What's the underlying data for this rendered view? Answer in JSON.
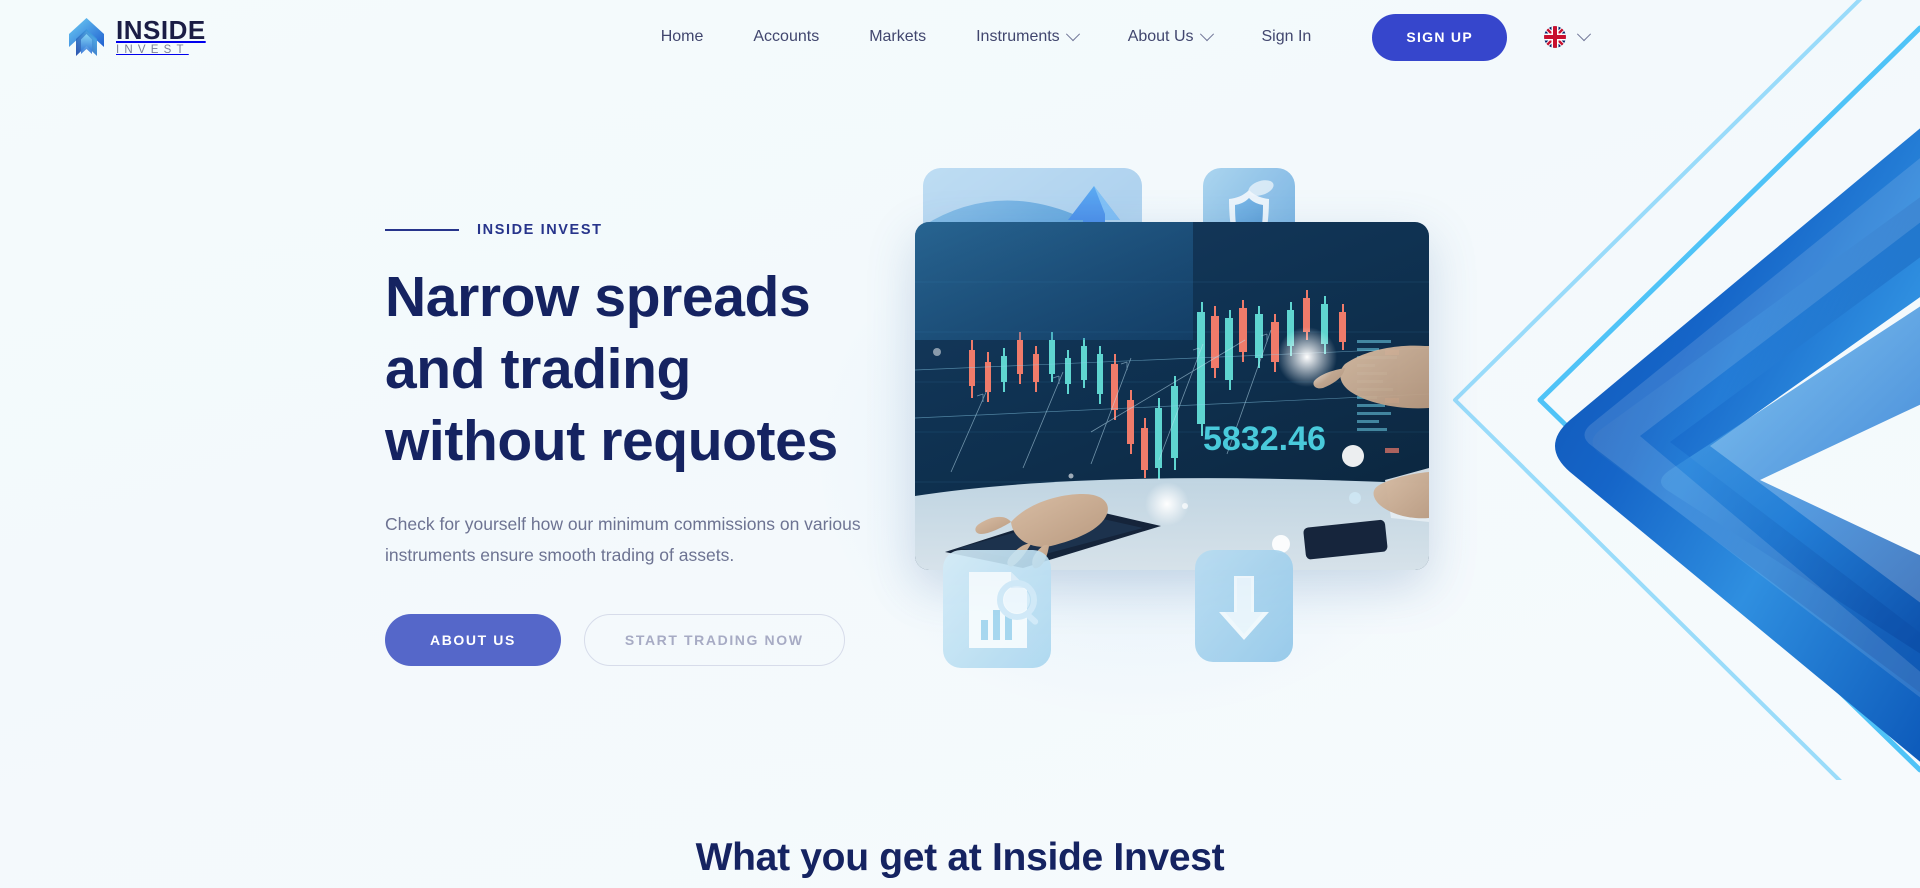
{
  "brand": {
    "name": "INSIDE",
    "tagline": "INVEST",
    "logo_icon": "arrow-chevron-logo-icon",
    "accent": "#3646cc",
    "navy": "#152361"
  },
  "nav": {
    "items": [
      {
        "label": "Home",
        "has_dropdown": false
      },
      {
        "label": "Accounts",
        "has_dropdown": false
      },
      {
        "label": "Markets",
        "has_dropdown": false
      },
      {
        "label": "Instruments",
        "has_dropdown": true
      },
      {
        "label": "About Us",
        "has_dropdown": true
      },
      {
        "label": "Sign In",
        "has_dropdown": false
      }
    ],
    "signup_label": "SIGN UP",
    "language": {
      "code": "EN",
      "flag_icon": "uk-flag-icon"
    }
  },
  "hero": {
    "eyebrow": "INSIDE INVEST",
    "title_line1": "Narrow spreads",
    "title_line2": "and trading",
    "title_line3": "without requotes",
    "subtitle": "Check for yourself how our minimum commissions on various instruments ensure smooth trading of assets.",
    "cta_primary": "ABOUT US",
    "cta_secondary": "START TRADING NOW",
    "image_ticker_value": "5832.46",
    "cards": [
      {
        "name": "growth-chart-card",
        "icon": "bar-chart-up-arrow-icon"
      },
      {
        "name": "security-shield-card",
        "icon": "shield-icon"
      },
      {
        "name": "document-analysis-card",
        "icon": "document-magnifier-icon"
      },
      {
        "name": "download-card",
        "icon": "download-arrow-icon"
      },
      {
        "name": "trading-screen-card",
        "icon": "trading-chart-photo"
      }
    ]
  },
  "section_below": {
    "title": "What you get at Inside Invest"
  }
}
